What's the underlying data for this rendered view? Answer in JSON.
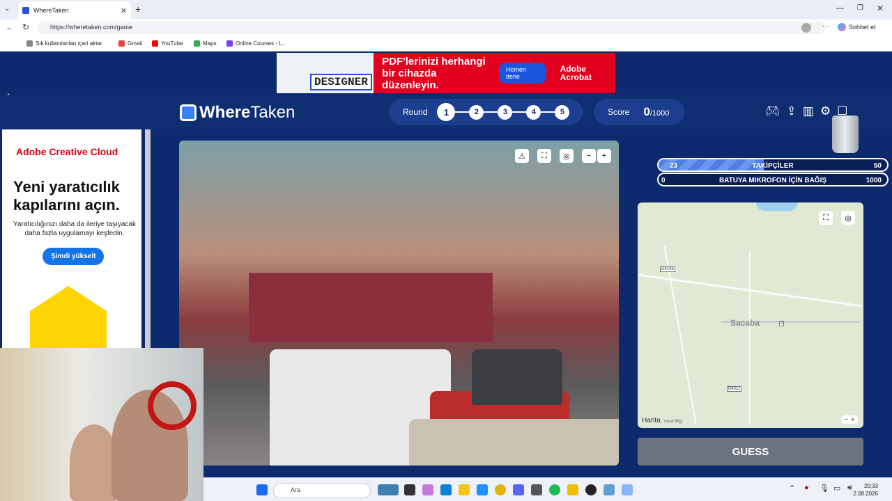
{
  "browser": {
    "tab_title": "WhereTaken",
    "url": "https://wheretaken.com/game",
    "copilot_label": "Sohbet et",
    "bookmarks": [
      "Sık kullanılanları içeri aktar",
      "Gmail",
      "YouTube",
      "Maps",
      "Online Courses - L..."
    ]
  },
  "top_ad": {
    "designer_label": "DESIGNER",
    "headline": "PDF'lerinizi herhangi bir cihazda düzenleyin.",
    "cta": "Hemen dene",
    "brand": "Adobe Acrobat"
  },
  "header": {
    "logo_where": "Where",
    "logo_taken": "Taken",
    "round_label": "Round",
    "rounds": [
      "1",
      "2",
      "3",
      "4",
      "5"
    ],
    "current_round": 1,
    "score_label": "Score",
    "score_value": "0",
    "score_max": "/1000"
  },
  "side_ad": {
    "brand": "Adobe Creative Cloud",
    "headline": "Yeni yaratıcılık kapılarını açın.",
    "body": "Yaratıcılığınızı daha da ileriye taşıyacak daha fazla uygulamayı keşfedin.",
    "cta": "Şimdi yükselt"
  },
  "goals": {
    "followers": {
      "current": "23",
      "label": "TAKİPÇİLER",
      "target": "50",
      "progress": 0.46
    },
    "donation": {
      "current": "0",
      "label": "BATUYA MIKROFON İÇİN BAĞIŞ",
      "target": "1000",
      "progress": 0
    }
  },
  "map": {
    "city": "Sacaba",
    "road_labels": [
      "D4143",
      "4",
      "D4311"
    ],
    "attribution": "Harita",
    "legal": "Yasal Bilgi"
  },
  "guess_button": "GUESS",
  "taskbar": {
    "search_placeholder": "Ara",
    "time": "20:33",
    "date": "2.08.2026"
  }
}
